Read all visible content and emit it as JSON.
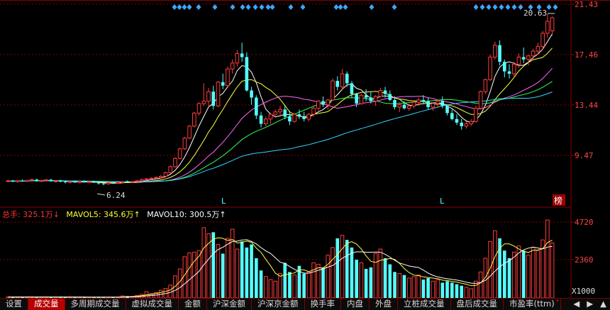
{
  "price_axis": {
    "labels": [
      "21.43",
      "17.46",
      "13.44",
      "9.47"
    ]
  },
  "volume_axis": {
    "labels": [
      "4720",
      "2360"
    ],
    "unit": "X1000"
  },
  "annotations": {
    "high_label": "20.63",
    "low_label": "6.24",
    "limit_marks": [
      "L",
      "L"
    ],
    "badge": "榜"
  },
  "volume_info": {
    "total": "总手: 325.1万↓",
    "mavol5": "MAVOL5: 345.6万↑",
    "mavol10": "MAVOL10: 300.5万↑"
  },
  "colors": {
    "up": "#ff3c3c",
    "down": "#54ffff",
    "ma5": "#ffffff",
    "ma10": "#ffff44",
    "ma20": "#ff66ff",
    "ma30": "#33ff55",
    "ma60": "#33d6ff",
    "grid": "#8a0000",
    "info_total": "#ff3333",
    "info_mavol5": "#ffff33",
    "info_mavol10": "#ffffff"
  },
  "tabs": [
    {
      "label": "设置",
      "active": false,
      "mark": false
    },
    {
      "label": "成交量",
      "active": true,
      "mark": true
    },
    {
      "label": "多周期成交量",
      "active": false,
      "mark": false
    },
    {
      "label": "虚拟成交量",
      "active": false,
      "mark": false
    },
    {
      "label": "金额",
      "active": false,
      "mark": false
    },
    {
      "label": "沪深金额",
      "active": false,
      "mark": false
    },
    {
      "label": "沪深京金额",
      "active": false,
      "mark": false
    },
    {
      "label": "换手率",
      "active": false,
      "mark": false
    },
    {
      "label": "内盘",
      "active": false,
      "mark": false
    },
    {
      "label": "外盘",
      "active": false,
      "mark": false
    },
    {
      "label": "立桩成交量",
      "active": false,
      "mark": false
    },
    {
      "label": "盘后成交量",
      "active": false,
      "mark": false
    },
    {
      "label": "市盈率(ttm)",
      "active": false,
      "mark": true
    }
  ],
  "tab_nav": [
    "◀",
    "▶",
    "▲"
  ],
  "chart_data": {
    "type": "candlestick",
    "price_range": [
      5.6,
      21.43
    ],
    "volume_range": [
      0,
      5200
    ],
    "candles": [
      [
        6.6,
        6.7,
        6.5,
        6.62,
        60
      ],
      [
        6.62,
        6.7,
        6.5,
        6.55,
        58
      ],
      [
        6.55,
        6.68,
        6.45,
        6.63,
        62
      ],
      [
        6.63,
        6.75,
        6.55,
        6.58,
        55
      ],
      [
        6.58,
        6.7,
        6.5,
        6.66,
        60
      ],
      [
        6.66,
        6.8,
        6.6,
        6.72,
        64
      ],
      [
        6.72,
        6.8,
        6.55,
        6.6,
        66
      ],
      [
        6.6,
        6.7,
        6.5,
        6.64,
        57
      ],
      [
        6.64,
        6.78,
        6.6,
        6.7,
        60
      ],
      [
        6.7,
        6.8,
        6.55,
        6.58,
        62
      ],
      [
        6.58,
        6.68,
        6.48,
        6.6,
        55
      ],
      [
        6.6,
        6.7,
        6.5,
        6.55,
        50
      ],
      [
        6.55,
        6.65,
        6.4,
        6.5,
        53
      ],
      [
        6.5,
        6.6,
        6.4,
        6.55,
        48
      ],
      [
        6.55,
        6.65,
        6.45,
        6.48,
        52
      ],
      [
        6.48,
        6.6,
        6.4,
        6.56,
        49
      ],
      [
        6.56,
        6.66,
        6.46,
        6.5,
        50
      ],
      [
        6.5,
        6.6,
        6.42,
        6.54,
        48
      ],
      [
        6.54,
        6.64,
        6.44,
        6.46,
        51
      ],
      [
        6.46,
        6.58,
        6.3,
        6.4,
        50
      ],
      [
        6.4,
        6.5,
        6.24,
        6.36,
        62
      ],
      [
        6.36,
        6.5,
        6.3,
        6.45,
        45
      ],
      [
        6.45,
        6.55,
        6.35,
        6.4,
        44
      ],
      [
        6.4,
        6.52,
        6.34,
        6.48,
        46
      ],
      [
        6.48,
        6.6,
        6.4,
        6.55,
        140
      ],
      [
        6.55,
        6.65,
        6.45,
        6.5,
        120
      ],
      [
        6.5,
        6.6,
        6.42,
        6.56,
        100
      ],
      [
        6.56,
        6.7,
        6.5,
        6.62,
        160
      ],
      [
        6.62,
        6.8,
        6.55,
        6.72,
        230
      ],
      [
        6.72,
        6.85,
        6.6,
        6.78,
        410
      ],
      [
        6.78,
        6.9,
        6.65,
        6.84,
        280
      ],
      [
        6.84,
        7.0,
        6.75,
        6.9,
        350
      ],
      [
        6.9,
        7.1,
        6.8,
        7.0,
        500
      ],
      [
        7.0,
        7.4,
        6.95,
        7.3,
        620
      ],
      [
        7.3,
        7.9,
        7.2,
        7.8,
        840
      ],
      [
        7.8,
        8.6,
        7.7,
        8.5,
        1450
      ],
      [
        8.5,
        9.4,
        8.4,
        9.3,
        1900
      ],
      [
        9.3,
        10.3,
        9.2,
        10.2,
        2700
      ],
      [
        10.2,
        11.3,
        10.1,
        11.2,
        2950
      ],
      [
        11.2,
        12.4,
        11.1,
        12.3,
        3000
      ],
      [
        12.3,
        13.2,
        12.1,
        13.1,
        3100
      ],
      [
        13.1,
        14.8,
        12.9,
        13.3,
        4600
      ],
      [
        13.3,
        14.4,
        12.8,
        14.1,
        4200
      ],
      [
        14.1,
        14.6,
        12.6,
        12.9,
        4300
      ],
      [
        12.9,
        15.0,
        12.8,
        14.9,
        3500
      ],
      [
        14.9,
        15.6,
        14.3,
        14.6,
        2900
      ],
      [
        14.6,
        16.2,
        14.4,
        16.0,
        3900
      ],
      [
        16.0,
        16.8,
        15.6,
        16.5,
        4500
      ],
      [
        16.5,
        17.6,
        16.2,
        17.3,
        3200
      ],
      [
        17.3,
        18.2,
        16.6,
        17.0,
        3700
      ],
      [
        17.0,
        17.4,
        14.1,
        14.2,
        3300
      ],
      [
        14.2,
        14.5,
        13.0,
        13.6,
        3500
      ],
      [
        13.6,
        13.8,
        11.8,
        12.1,
        2600
      ],
      [
        12.1,
        12.4,
        11.1,
        11.4,
        1800
      ],
      [
        11.4,
        12.0,
        11.2,
        11.8,
        1400
      ],
      [
        11.8,
        12.3,
        11.4,
        12.2,
        1200
      ],
      [
        12.2,
        12.6,
        11.9,
        12.4,
        1100
      ],
      [
        12.4,
        12.9,
        12.0,
        12.6,
        1600
      ],
      [
        12.6,
        13.0,
        11.8,
        12.0,
        2300
      ],
      [
        12.0,
        12.5,
        11.3,
        11.6,
        1700
      ],
      [
        11.6,
        12.3,
        11.5,
        12.2,
        1500
      ],
      [
        12.2,
        12.6,
        11.8,
        12.0,
        2100
      ],
      [
        12.0,
        12.4,
        11.6,
        11.8,
        1600
      ],
      [
        11.8,
        12.3,
        11.6,
        12.2,
        1700
      ],
      [
        12.2,
        12.8,
        12.0,
        12.7,
        2300
      ],
      [
        12.7,
        13.4,
        12.5,
        13.3,
        2200
      ],
      [
        13.3,
        13.7,
        12.8,
        13.0,
        2000
      ],
      [
        13.0,
        13.5,
        12.6,
        13.4,
        2800
      ],
      [
        13.4,
        15.2,
        13.3,
        15.0,
        3300
      ],
      [
        15.0,
        15.4,
        14.2,
        14.5,
        3900
      ],
      [
        14.5,
        16.0,
        14.2,
        15.6,
        4100
      ],
      [
        15.6,
        15.8,
        14.5,
        14.8,
        3800
      ],
      [
        14.8,
        15.0,
        13.6,
        13.9,
        3300
      ],
      [
        13.9,
        14.0,
        12.8,
        13.1,
        2500
      ],
      [
        13.1,
        13.9,
        13.0,
        13.8,
        2300
      ],
      [
        13.8,
        14.3,
        13.3,
        13.6,
        1900
      ],
      [
        13.6,
        14.1,
        13.1,
        13.3,
        2000
      ],
      [
        13.3,
        13.8,
        12.9,
        13.7,
        2900
      ],
      [
        13.7,
        14.4,
        13.6,
        14.2,
        3200
      ],
      [
        14.2,
        14.5,
        13.6,
        13.9,
        2600
      ],
      [
        13.9,
        14.2,
        13.3,
        13.4,
        2200
      ],
      [
        13.4,
        13.7,
        12.6,
        12.8,
        1700
      ],
      [
        12.8,
        13.2,
        12.4,
        13.0,
        1600
      ],
      [
        13.0,
        13.3,
        12.6,
        12.7,
        1500
      ],
      [
        12.7,
        13.1,
        12.5,
        12.9,
        1300
      ],
      [
        12.9,
        13.4,
        12.7,
        13.2,
        1400
      ],
      [
        13.2,
        13.6,
        12.9,
        13.4,
        1500
      ],
      [
        13.4,
        13.8,
        13.1,
        13.3,
        1200
      ],
      [
        13.3,
        13.6,
        12.6,
        12.8,
        1300
      ],
      [
        12.8,
        13.2,
        12.5,
        13.1,
        1100
      ],
      [
        13.1,
        13.4,
        12.8,
        13.3,
        1200
      ],
      [
        13.3,
        13.7,
        12.7,
        12.9,
        1000
      ],
      [
        12.9,
        13.0,
        12.1,
        12.3,
        1100
      ],
      [
        12.3,
        12.6,
        11.7,
        11.8,
        1000
      ],
      [
        11.8,
        12.2,
        11.3,
        11.5,
        900
      ],
      [
        11.5,
        11.8,
        10.9,
        11.2,
        800
      ],
      [
        11.2,
        11.6,
        11.0,
        11.4,
        700
      ],
      [
        11.4,
        11.8,
        11.2,
        11.6,
        600
      ],
      [
        11.6,
        12.9,
        11.5,
        12.7,
        1100
      ],
      [
        12.7,
        14.2,
        12.6,
        14.1,
        1700
      ],
      [
        14.1,
        15.2,
        13.9,
        15.1,
        2600
      ],
      [
        15.1,
        17.2,
        15.0,
        17.0,
        3700
      ],
      [
        17.0,
        18.3,
        16.8,
        18.0,
        4400
      ],
      [
        18.0,
        18.4,
        16.3,
        16.6,
        3900
      ],
      [
        16.6,
        16.8,
        15.3,
        15.8,
        3100
      ],
      [
        15.8,
        16.4,
        15.2,
        15.6,
        2600
      ],
      [
        15.6,
        16.6,
        15.3,
        16.4,
        3000
      ],
      [
        16.4,
        17.3,
        16.1,
        17.0,
        3400
      ],
      [
        17.0,
        17.8,
        16.5,
        16.8,
        3100
      ],
      [
        16.8,
        17.2,
        16.3,
        17.1,
        2800
      ],
      [
        17.1,
        17.7,
        16.8,
        17.5,
        3300
      ],
      [
        17.5,
        18.2,
        17.2,
        17.9,
        3100
      ],
      [
        17.9,
        19.2,
        17.6,
        19.0,
        3800
      ],
      [
        19.0,
        20.63,
        18.6,
        20.0,
        5100
      ],
      [
        19.2,
        20.4,
        18.8,
        20.3,
        3600
      ]
    ]
  }
}
